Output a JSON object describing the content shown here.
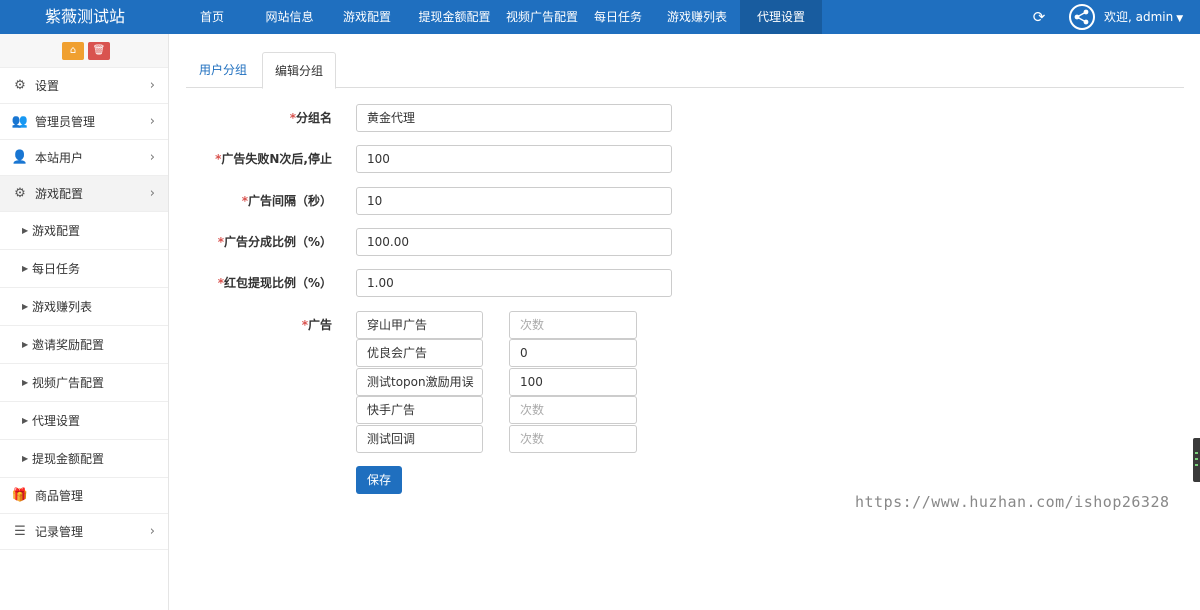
{
  "header": {
    "brand": "紫薇测试站",
    "nav": [
      "首页",
      "网站信息",
      "游戏配置",
      "提现金额配置",
      "视频广告配置",
      "每日任务",
      "游戏赚列表",
      "代理设置"
    ],
    "active_nav": "代理设置",
    "refresh_icon": "refresh-icon",
    "share_icon": "share-icon",
    "user": "欢迎, admin"
  },
  "sidebar": {
    "tools": [
      "home-icon",
      "trash-icon"
    ],
    "items": [
      {
        "label": "设置",
        "icon": "gears-icon"
      },
      {
        "label": "管理员管理",
        "icon": "users-icon"
      },
      {
        "label": "本站用户",
        "icon": "user-icon"
      },
      {
        "label": "游戏配置",
        "icon": "gears-icon"
      }
    ],
    "subitems": [
      "游戏配置",
      "每日任务",
      "游戏赚列表",
      "邀请奖励配置",
      "视频广告配置",
      "代理设置",
      "提现金额配置"
    ],
    "bottom_items": [
      {
        "label": "商品管理",
        "icon": "gift-icon"
      },
      {
        "label": "记录管理",
        "icon": "list-icon"
      }
    ]
  },
  "tabs": {
    "user_group": "用户分组",
    "edit_group": "编辑分组"
  },
  "form": {
    "group_name_label": "分组名",
    "group_name_value": "黄金代理",
    "ad_fail_label": "广告失败N次后,停止",
    "ad_fail_value": "100",
    "ad_interval_label": "广告间隔（秒）",
    "ad_interval_value": "10",
    "ad_share_label": "广告分成比例（%）",
    "ad_share_value": "100.00",
    "redpack_label": "红包提现比例（%）",
    "redpack_value": "1.00",
    "ads_label": "广告",
    "ads": [
      {
        "name": "穿山甲广告",
        "count": "",
        "placeholder": "次数"
      },
      {
        "name": "优良会广告",
        "count": "0",
        "placeholder": "次数"
      },
      {
        "name": "测试topon激励用误",
        "count": "100",
        "placeholder": "次数"
      },
      {
        "name": "快手广告",
        "count": "",
        "placeholder": "次数"
      },
      {
        "name": "测试回调",
        "count": "",
        "placeholder": "次数"
      }
    ],
    "save": "保存"
  },
  "watermark": "https://www.huzhan.com/ishop26328",
  "colors": {
    "primary": "#1f6fbf",
    "danger": "#d9534f",
    "warning": "#f0a030"
  }
}
